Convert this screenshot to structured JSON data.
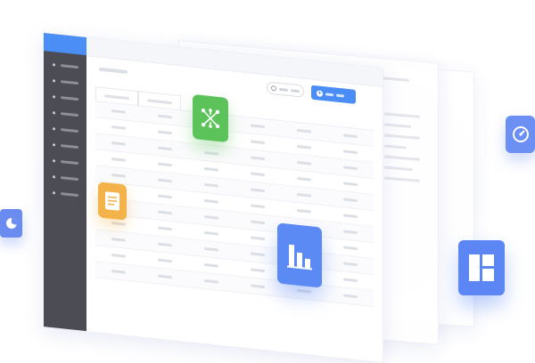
{
  "sidebar": {
    "item_count": 9
  },
  "main_table": {
    "row_count": 11,
    "column_count": 6
  },
  "back_sheet_labels": {
    "top_small": "",
    "top_link": ""
  },
  "tiles": [
    {
      "icon": "network-graph-icon",
      "color": "#5cc35a"
    },
    {
      "icon": "document-icon",
      "color": "#f3b24a"
    },
    {
      "icon": "bar-chart-icon",
      "color": "#5b8af5"
    },
    {
      "icon": "gauge-icon",
      "color": "#6b8ff3"
    },
    {
      "icon": "layout-grid-icon",
      "color": "#5b86f4"
    },
    {
      "icon": "clock-icon",
      "color": "#6a8cf1"
    }
  ],
  "colors": {
    "sidebar_bg": "#4b4c54",
    "accent": "#4a8df6",
    "background": "#ffffff"
  }
}
